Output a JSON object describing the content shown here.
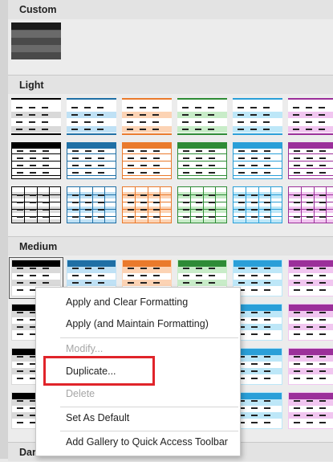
{
  "sections": {
    "custom": "Custom",
    "light": "Light",
    "medium": "Medium",
    "dark": "Dark"
  },
  "colors": {
    "palette": [
      "#000000",
      "#1f6fa5",
      "#ea7a2c",
      "#2e8b36",
      "#2a9fd8",
      "#9b2f9a"
    ],
    "palette_light": [
      "#d9d9d9",
      "#bfe1f5",
      "#fcd3b4",
      "#c8ecc8",
      "#bde7f8",
      "#f1c6f0"
    ],
    "selection_highlight": "#e0242a"
  },
  "context_menu": {
    "items": [
      {
        "label": "Apply and Clear Formatting",
        "enabled": true
      },
      {
        "label": "Apply (and Maintain Formatting)",
        "enabled": true
      },
      {
        "label": "Modify...",
        "enabled": false
      },
      {
        "label": "Duplicate...",
        "enabled": true,
        "highlighted": true
      },
      {
        "label": "Delete",
        "enabled": false
      },
      {
        "label": "Set As Default",
        "enabled": true
      },
      {
        "label": "Add Gallery to Quick Access Toolbar",
        "enabled": true
      }
    ]
  }
}
